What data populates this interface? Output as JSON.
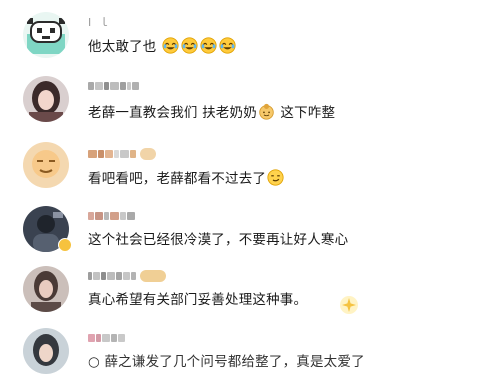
{
  "comments": [
    {
      "username": "I  ｌ",
      "text": "他太敢了也",
      "emojis": [
        "laugh-cry-emoji",
        "laugh-cry-emoji",
        "laugh-cry-emoji",
        "laugh-cry-emoji"
      ]
    },
    {
      "username": "",
      "text_a": "老薛一直教会我们 扶老奶奶",
      "emoji_mid": "grandma-emoji",
      "text_b": " 这下咋整"
    },
    {
      "username": "",
      "text": "看吧看吧，老薛都看不过去了",
      "emoji_end": "smirk-emoji"
    },
    {
      "username": "",
      "text": "这个社会已经很冷漠了，不要再让好人寒心"
    },
    {
      "username": "",
      "text": "真心希望有关部门妥善处理这种事。"
    },
    {
      "username": "",
      "text": "○ 薛之谦发了几个问号都给整了，真是太爱了"
    }
  ],
  "colors": {
    "text": "#1a1a1a",
    "blurred_name": "#b9b9b9",
    "badge_gold": "#f6c23e",
    "laugh_face": "#ffcb3d"
  }
}
